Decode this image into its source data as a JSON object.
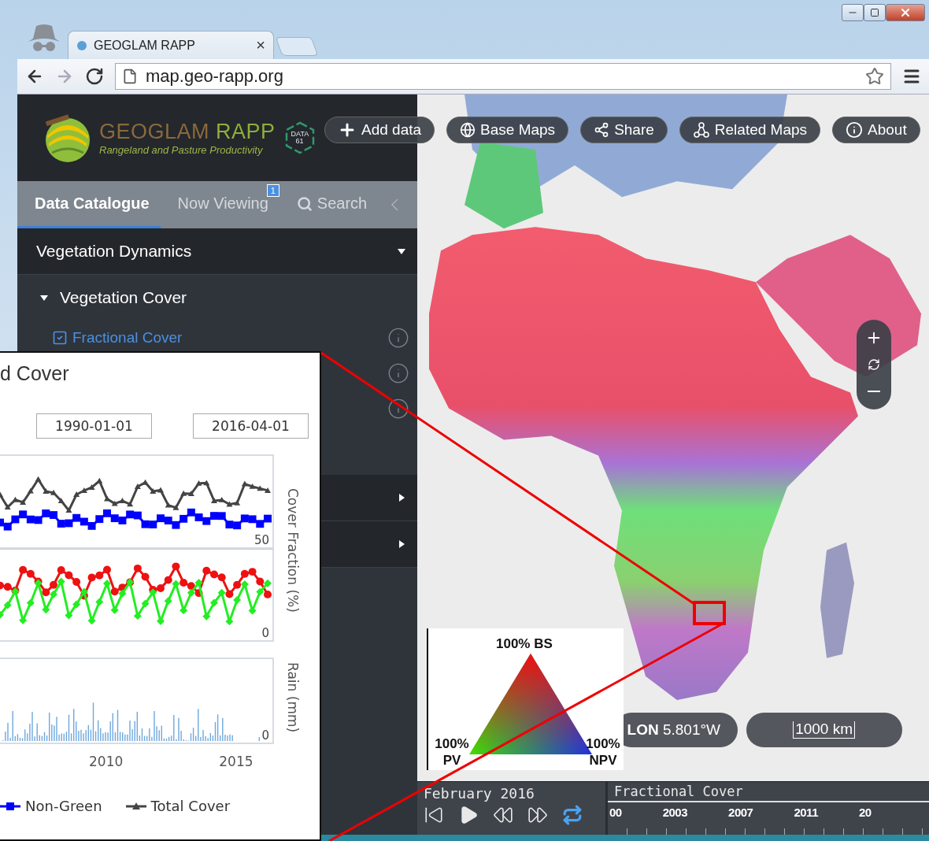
{
  "browser": {
    "tab_title": "GEOGLAM RAPP",
    "tab_close": "×",
    "url": "map.geo-rapp.org"
  },
  "sidebar": {
    "logo_title_1": "GEOGLAM",
    "logo_title_2": "RAPP",
    "logo_subtitle": "Rangeland and Pasture Productivity",
    "partner_logo": "DATA 61",
    "tabs": [
      {
        "label": "Data Catalogue",
        "selected": true,
        "kind": "tab"
      },
      {
        "label": "Now Viewing",
        "selected": false,
        "kind": "tab",
        "badge": "1"
      },
      {
        "label": "Search",
        "selected": false,
        "kind": "search"
      }
    ],
    "groups": [
      {
        "label": "Vegetation Dynamics",
        "expanded": true,
        "children": [
          {
            "label": "Vegetation Cover",
            "expanded": true,
            "children": [
              {
                "kind": "layer",
                "label": "Fractional Cover",
                "checked": true
              },
              {
                "kind": "hidden"
              },
              {
                "kind": "hidden"
              }
            ]
          }
        ]
      },
      {
        "expanded": false
      },
      {
        "expanded": false
      }
    ]
  },
  "map": {
    "buttons": [
      {
        "label": "Add data",
        "kind": "add"
      },
      {
        "label": "Base Maps",
        "kind": "globe"
      },
      {
        "label": "Share",
        "kind": "share"
      },
      {
        "label": "Related Maps",
        "kind": "related"
      },
      {
        "label": "About",
        "kind": "info"
      }
    ],
    "legend": {
      "top": "100% BS",
      "left": "100% PV",
      "right": "100% NPV"
    },
    "location": "**LON** 5.801°W",
    "scale": "1000 km"
  },
  "timeline": {
    "date": "February 2016",
    "loop_on": true,
    "title": "Fractional Cover",
    "ticks": [
      "00",
      "2003",
      "2007",
      "2011",
      "20"
    ]
  },
  "inset": {
    "title": "d Cover",
    "date_from": "1990-01-01",
    "date_to": "2016-04-01",
    "cover_tick": "50",
    "fraction_tick": "0",
    "rain_tick": "0",
    "cover_axis_label": "Cover Fraction (%)",
    "rain_axis_label": "Rain (mm)",
    "x_ticks": [
      "2010",
      "2015"
    ],
    "legend": [
      {
        "label": "Non-Green",
        "color": "#0000ff",
        "kind": "square"
      },
      {
        "label": "Total Cover",
        "color": "#444444",
        "kind": "triangle"
      }
    ]
  }
}
